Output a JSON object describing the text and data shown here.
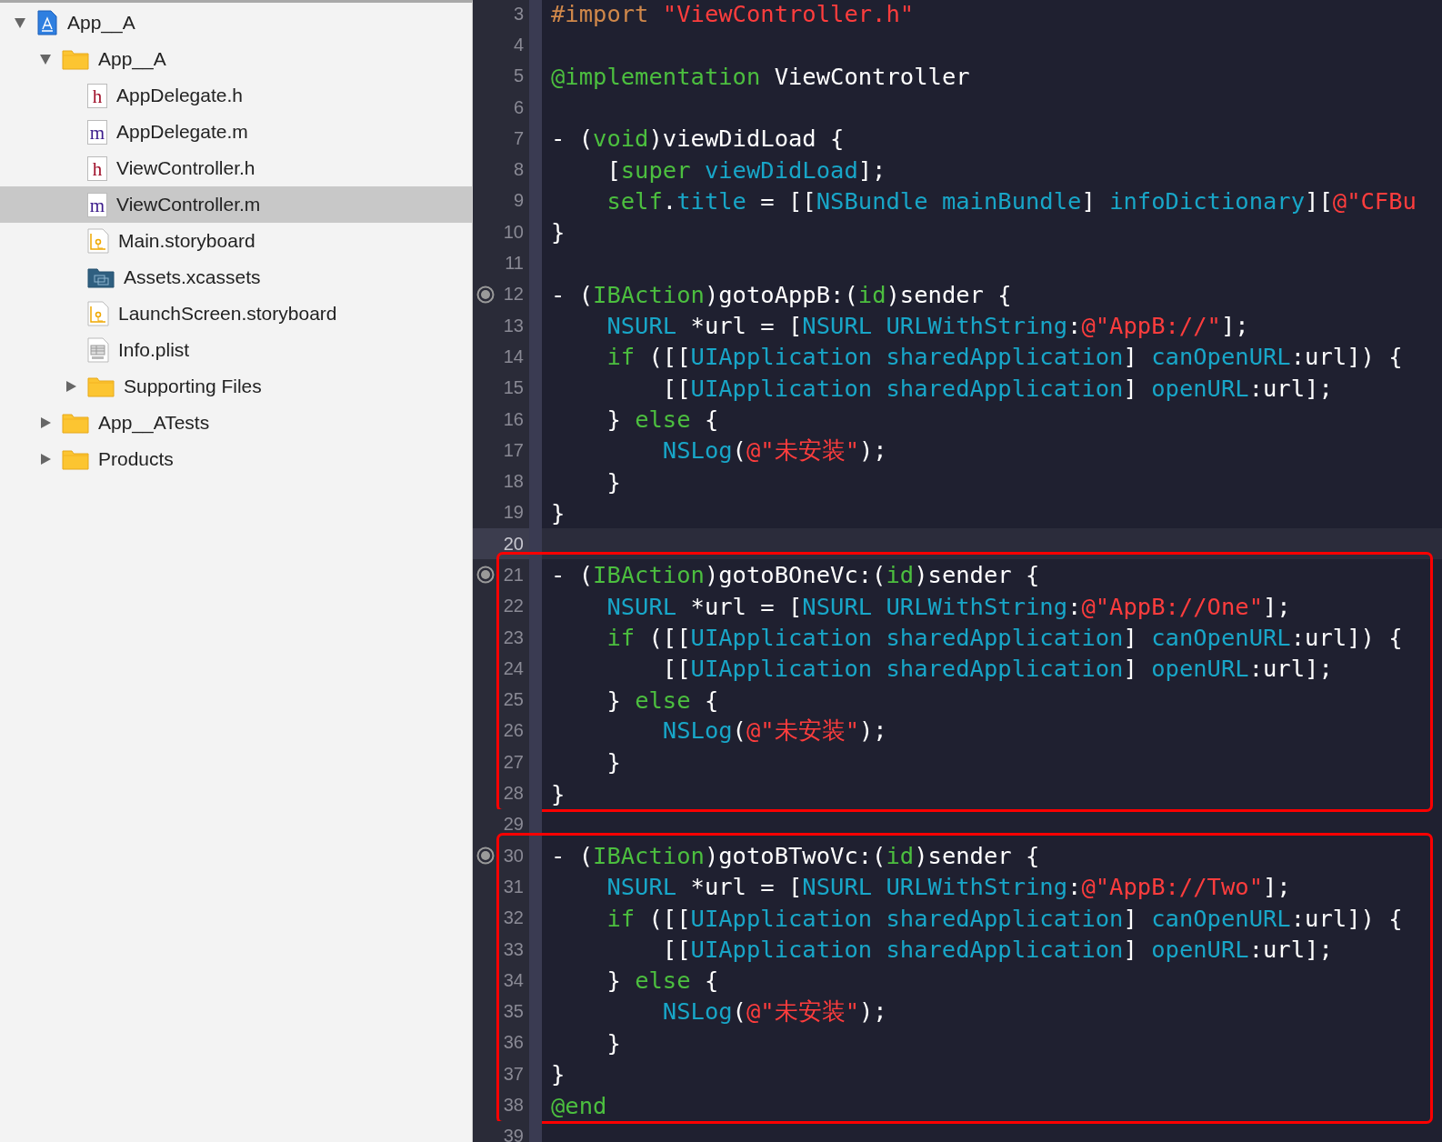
{
  "navigator": {
    "items": [
      {
        "label": "App__A",
        "kind": "project",
        "expanded": true,
        "selected": false,
        "children": [
          {
            "label": "App__A",
            "kind": "folder",
            "expanded": true,
            "selected": false,
            "children": [
              {
                "label": "AppDelegate.h",
                "kind": "header",
                "icon_letter": "h",
                "selected": false
              },
              {
                "label": "AppDelegate.m",
                "kind": "source",
                "icon_letter": "m",
                "selected": false
              },
              {
                "label": "ViewController.h",
                "kind": "header",
                "icon_letter": "h",
                "selected": false
              },
              {
                "label": "ViewController.m",
                "kind": "source",
                "icon_letter": "m",
                "selected": true
              },
              {
                "label": "Main.storyboard",
                "kind": "storyboard",
                "selected": false
              },
              {
                "label": "Assets.xcassets",
                "kind": "assets",
                "selected": false
              },
              {
                "label": "LaunchScreen.storyboard",
                "kind": "storyboard",
                "selected": false
              },
              {
                "label": "Info.plist",
                "kind": "plist",
                "selected": false
              },
              {
                "label": "Supporting Files",
                "kind": "folder",
                "expanded": false,
                "selected": false
              }
            ]
          },
          {
            "label": "App__ATests",
            "kind": "folder",
            "expanded": false,
            "selected": false
          },
          {
            "label": "Products",
            "kind": "folder",
            "expanded": false,
            "selected": false
          }
        ]
      }
    ]
  },
  "editor": {
    "blocks": [
      {
        "boxed": false,
        "lines": [
          {
            "n": "3",
            "outlet": false,
            "current": false,
            "tokens": [
              {
                "kind": "directive",
                "text": "#import "
              },
              {
                "kind": "string",
                "text": "\"ViewController.h\""
              }
            ]
          },
          {
            "n": "4",
            "outlet": false,
            "current": false
          },
          {
            "n": "5",
            "outlet": false,
            "current": false,
            "tokens": [
              {
                "kind": "keyword",
                "text": "@implementation"
              },
              {
                "kind": "plain",
                "text": " ViewController"
              }
            ]
          },
          {
            "n": "6",
            "outlet": false,
            "current": false
          },
          {
            "n": "7",
            "outlet": false,
            "current": false,
            "tokens": [
              {
                "kind": "plain",
                "text": "- ("
              },
              {
                "kind": "keyword",
                "text": "void"
              },
              {
                "kind": "plain",
                "text": ")viewDidLoad {"
              }
            ]
          },
          {
            "n": "8",
            "outlet": false,
            "current": false,
            "tokens": [
              {
                "kind": "plain",
                "text": "    ["
              },
              {
                "kind": "keyword",
                "text": "super"
              },
              {
                "kind": "type",
                "text": " viewDidLoad"
              },
              {
                "kind": "plain",
                "text": "];"
              }
            ]
          },
          {
            "n": "9",
            "outlet": false,
            "current": false,
            "tokens": [
              {
                "kind": "keyword",
                "text": "    self"
              },
              {
                "kind": "plain",
                "text": "."
              },
              {
                "kind": "type",
                "text": "title"
              },
              {
                "kind": "plain",
                "text": " = [["
              },
              {
                "kind": "type",
                "text": "NSBundle mainBundle"
              },
              {
                "kind": "plain",
                "text": "] "
              },
              {
                "kind": "type",
                "text": "infoDictionary"
              },
              {
                "kind": "plain",
                "text": "]["
              },
              {
                "kind": "string",
                "text": "@\"CFBu"
              }
            ]
          },
          {
            "n": "10",
            "outlet": false,
            "current": false,
            "tokens": [
              {
                "kind": "plain",
                "text": "}"
              }
            ]
          },
          {
            "n": "11",
            "outlet": false,
            "current": false
          },
          {
            "n": "12",
            "outlet": true,
            "current": false,
            "tokens": [
              {
                "kind": "plain",
                "text": "- ("
              },
              {
                "kind": "keyword",
                "text": "IBAction"
              },
              {
                "kind": "plain",
                "text": ")gotoAppB:("
              },
              {
                "kind": "keyword",
                "text": "id"
              },
              {
                "kind": "plain",
                "text": ")sender {"
              }
            ]
          },
          {
            "n": "13",
            "outlet": false,
            "current": false,
            "tokens": [
              {
                "kind": "type",
                "text": "    NSURL"
              },
              {
                "kind": "plain",
                "text": " *url = ["
              },
              {
                "kind": "type",
                "text": "NSURL URLWithString"
              },
              {
                "kind": "plain",
                "text": ":"
              },
              {
                "kind": "string",
                "text": "@\"AppB://\""
              },
              {
                "kind": "plain",
                "text": "];"
              }
            ]
          },
          {
            "n": "14",
            "outlet": false,
            "current": false,
            "tokens": [
              {
                "kind": "keyword",
                "text": "    if"
              },
              {
                "kind": "plain",
                "text": " ([["
              },
              {
                "kind": "type",
                "text": "UIApplication sharedApplication"
              },
              {
                "kind": "plain",
                "text": "] "
              },
              {
                "kind": "type",
                "text": "canOpenURL"
              },
              {
                "kind": "plain",
                "text": ":url]) {"
              }
            ]
          },
          {
            "n": "15",
            "outlet": false,
            "current": false,
            "tokens": [
              {
                "kind": "plain",
                "text": "        [["
              },
              {
                "kind": "type",
                "text": "UIApplication sharedApplication"
              },
              {
                "kind": "plain",
                "text": "] "
              },
              {
                "kind": "type",
                "text": "openURL"
              },
              {
                "kind": "plain",
                "text": ":url];"
              }
            ]
          },
          {
            "n": "16",
            "outlet": false,
            "current": false,
            "tokens": [
              {
                "kind": "plain",
                "text": "    } "
              },
              {
                "kind": "keyword",
                "text": "else"
              },
              {
                "kind": "plain",
                "text": " {"
              }
            ]
          },
          {
            "n": "17",
            "outlet": false,
            "current": false,
            "tokens": [
              {
                "kind": "type",
                "text": "        NSLog"
              },
              {
                "kind": "plain",
                "text": "("
              },
              {
                "kind": "string",
                "text": "@\"未安装\""
              },
              {
                "kind": "plain",
                "text": ");"
              }
            ]
          },
          {
            "n": "18",
            "outlet": false,
            "current": false,
            "tokens": [
              {
                "kind": "plain",
                "text": "    }"
              }
            ]
          },
          {
            "n": "19",
            "outlet": false,
            "current": false,
            "tokens": [
              {
                "kind": "plain",
                "text": "}"
              }
            ]
          },
          {
            "n": "20",
            "outlet": false,
            "current": true
          }
        ]
      },
      {
        "boxed": true,
        "lines": [
          {
            "n": "21",
            "outlet": true,
            "current": false,
            "tokens": [
              {
                "kind": "plain",
                "text": "- ("
              },
              {
                "kind": "keyword",
                "text": "IBAction"
              },
              {
                "kind": "plain",
                "text": ")gotoBOneVc:("
              },
              {
                "kind": "keyword",
                "text": "id"
              },
              {
                "kind": "plain",
                "text": ")sender {"
              }
            ]
          },
          {
            "n": "22",
            "outlet": false,
            "current": false,
            "tokens": [
              {
                "kind": "type",
                "text": "    NSURL"
              },
              {
                "kind": "plain",
                "text": " *url = ["
              },
              {
                "kind": "type",
                "text": "NSURL URLWithString"
              },
              {
                "kind": "plain",
                "text": ":"
              },
              {
                "kind": "string",
                "text": "@\"AppB://One\""
              },
              {
                "kind": "plain",
                "text": "];"
              }
            ]
          },
          {
            "n": "23",
            "outlet": false,
            "current": false,
            "tokens": [
              {
                "kind": "keyword",
                "text": "    if"
              },
              {
                "kind": "plain",
                "text": " ([["
              },
              {
                "kind": "type",
                "text": "UIApplication sharedApplication"
              },
              {
                "kind": "plain",
                "text": "] "
              },
              {
                "kind": "type",
                "text": "canOpenURL"
              },
              {
                "kind": "plain",
                "text": ":url]) {"
              }
            ]
          },
          {
            "n": "24",
            "outlet": false,
            "current": false,
            "tokens": [
              {
                "kind": "plain",
                "text": "        [["
              },
              {
                "kind": "type",
                "text": "UIApplication sharedApplication"
              },
              {
                "kind": "plain",
                "text": "] "
              },
              {
                "kind": "type",
                "text": "openURL"
              },
              {
                "kind": "plain",
                "text": ":url];"
              }
            ]
          },
          {
            "n": "25",
            "outlet": false,
            "current": false,
            "tokens": [
              {
                "kind": "plain",
                "text": "    } "
              },
              {
                "kind": "keyword",
                "text": "else"
              },
              {
                "kind": "plain",
                "text": " {"
              }
            ]
          },
          {
            "n": "26",
            "outlet": false,
            "current": false,
            "tokens": [
              {
                "kind": "type",
                "text": "        NSLog"
              },
              {
                "kind": "plain",
                "text": "("
              },
              {
                "kind": "string",
                "text": "@\"未安装\""
              },
              {
                "kind": "plain",
                "text": ");"
              }
            ]
          },
          {
            "n": "27",
            "outlet": false,
            "current": false,
            "tokens": [
              {
                "kind": "plain",
                "text": "    }"
              }
            ]
          },
          {
            "n": "28",
            "outlet": false,
            "current": false,
            "tokens": [
              {
                "kind": "plain",
                "text": "}"
              }
            ]
          }
        ]
      },
      {
        "boxed": false,
        "lines": [
          {
            "n": "29",
            "outlet": false,
            "current": false
          }
        ]
      },
      {
        "boxed": true,
        "lines": [
          {
            "n": "30",
            "outlet": true,
            "current": false,
            "tokens": [
              {
                "kind": "plain",
                "text": "- ("
              },
              {
                "kind": "keyword",
                "text": "IBAction"
              },
              {
                "kind": "plain",
                "text": ")gotoBTwoVc:("
              },
              {
                "kind": "keyword",
                "text": "id"
              },
              {
                "kind": "plain",
                "text": ")sender {"
              }
            ]
          },
          {
            "n": "31",
            "outlet": false,
            "current": false,
            "tokens": [
              {
                "kind": "type",
                "text": "    NSURL"
              },
              {
                "kind": "plain",
                "text": " *url = ["
              },
              {
                "kind": "type",
                "text": "NSURL URLWithString"
              },
              {
                "kind": "plain",
                "text": ":"
              },
              {
                "kind": "string",
                "text": "@\"AppB://Two\""
              },
              {
                "kind": "plain",
                "text": "];"
              }
            ]
          },
          {
            "n": "32",
            "outlet": false,
            "current": false,
            "tokens": [
              {
                "kind": "keyword",
                "text": "    if"
              },
              {
                "kind": "plain",
                "text": " ([["
              },
              {
                "kind": "type",
                "text": "UIApplication sharedApplication"
              },
              {
                "kind": "plain",
                "text": "] "
              },
              {
                "kind": "type",
                "text": "canOpenURL"
              },
              {
                "kind": "plain",
                "text": ":url]) {"
              }
            ]
          },
          {
            "n": "33",
            "outlet": false,
            "current": false,
            "tokens": [
              {
                "kind": "plain",
                "text": "        [["
              },
              {
                "kind": "type",
                "text": "UIApplication sharedApplication"
              },
              {
                "kind": "plain",
                "text": "] "
              },
              {
                "kind": "type",
                "text": "openURL"
              },
              {
                "kind": "plain",
                "text": ":url];"
              }
            ]
          },
          {
            "n": "34",
            "outlet": false,
            "current": false,
            "tokens": [
              {
                "kind": "plain",
                "text": "    } "
              },
              {
                "kind": "keyword",
                "text": "else"
              },
              {
                "kind": "plain",
                "text": " {"
              }
            ]
          },
          {
            "n": "35",
            "outlet": false,
            "current": false,
            "tokens": [
              {
                "kind": "type",
                "text": "        NSLog"
              },
              {
                "kind": "plain",
                "text": "("
              },
              {
                "kind": "string",
                "text": "@\"未安装\""
              },
              {
                "kind": "plain",
                "text": ");"
              }
            ]
          },
          {
            "n": "36",
            "outlet": false,
            "current": false,
            "tokens": [
              {
                "kind": "plain",
                "text": "    }"
              }
            ]
          },
          {
            "n": "37",
            "outlet": false,
            "current": false,
            "tokens": [
              {
                "kind": "plain",
                "text": "}"
              }
            ]
          },
          {
            "n": "38",
            "outlet": false,
            "current": false,
            "tokens": [
              {
                "kind": "keyword",
                "text": "@end"
              }
            ]
          }
        ]
      },
      {
        "boxed": false,
        "lines": [
          {
            "n": "39",
            "outlet": false,
            "current": false
          }
        ]
      }
    ]
  }
}
